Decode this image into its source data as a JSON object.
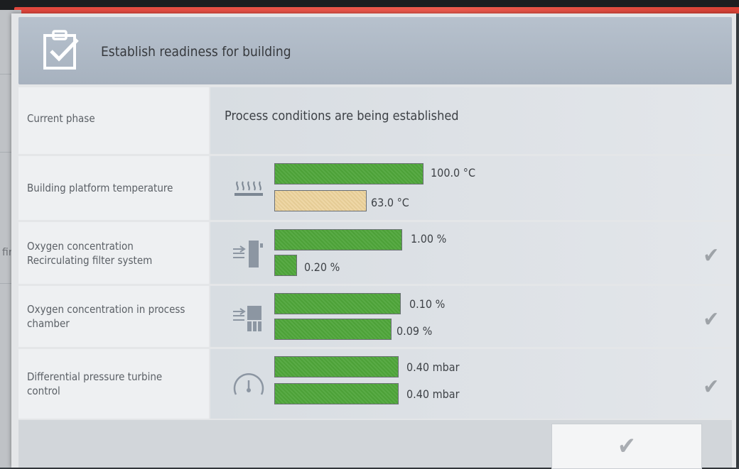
{
  "dialog": {
    "title": "Establish readiness for building",
    "header_icon": "clipboard-check-icon"
  },
  "background": {
    "partial_text": "fine"
  },
  "phase": {
    "label": "Current phase",
    "value": "Process conditions are being established"
  },
  "indicators": [
    {
      "label": "Building platform temperature",
      "icon": "heated-platform-icon",
      "target_value": "100.0 °C",
      "actual_value": "63.0 °C",
      "actual_fraction": 0.63,
      "actual_status": "pending",
      "checked": false
    },
    {
      "label": "Oxygen concentration Recirculating filter system",
      "icon": "filter-system-icon",
      "target_value": "1.00 %",
      "actual_value": "0.20 %",
      "actual_fraction": 0.2,
      "actual_status": "ok",
      "checked": true
    },
    {
      "label": "Oxygen concentration in process chamber",
      "icon": "process-chamber-icon",
      "target_value": "0.10 %",
      "actual_value": "0.09 %",
      "actual_fraction": 0.9,
      "actual_status": "ok",
      "checked": true
    },
    {
      "label": "Differential pressure turbine control",
      "icon": "pressure-gauge-icon",
      "target_value": "0.40 mbar",
      "actual_value": "0.40 mbar",
      "actual_fraction": 1.0,
      "actual_status": "ok",
      "checked": true
    }
  ],
  "footer": {
    "confirm_icon": "checkmark-icon"
  },
  "colors": {
    "ok": "#4fa63a",
    "pending": "#ecd29a",
    "accent_strip": "#e2473d"
  }
}
